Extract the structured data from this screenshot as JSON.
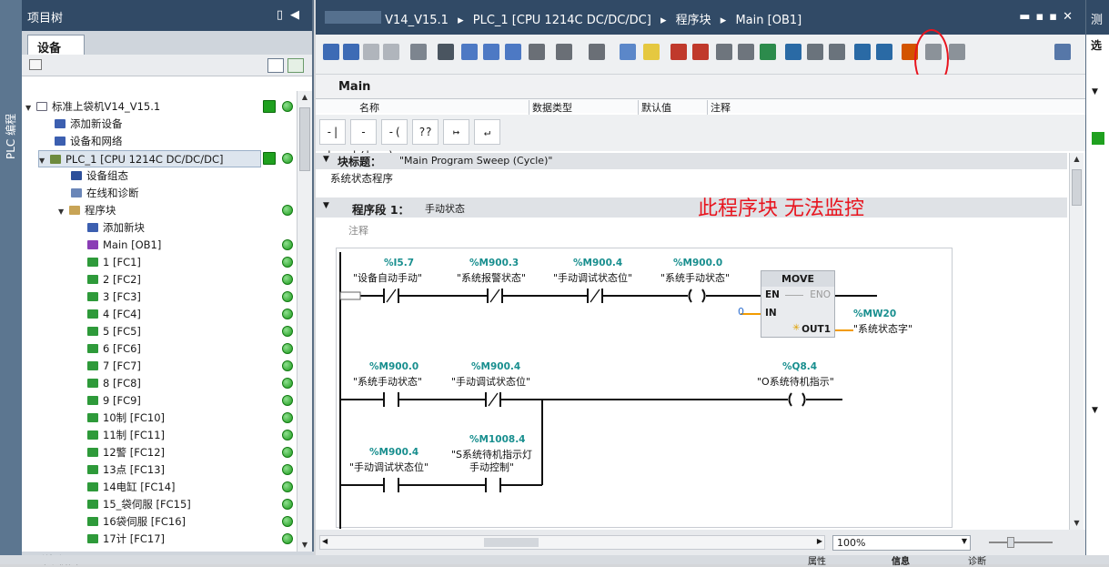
{
  "left_strip": {
    "label": "PLC 编程"
  },
  "project_tree": {
    "title": "项目树",
    "tab": "设备",
    "items": [
      {
        "label": "标准上袋机V14_V15.1",
        "status": "ok"
      },
      {
        "label": "添加新设备"
      },
      {
        "label": "设备和网络"
      },
      {
        "label": "PLC_1 [CPU 1214C DC/DC/DC]",
        "status": "ok"
      },
      {
        "label": "设备组态"
      },
      {
        "label": "在线和诊断"
      },
      {
        "label": "程序块"
      },
      {
        "label": "添加新块"
      },
      {
        "label": "Main [OB1]"
      },
      {
        "label": "1 [FC1]"
      },
      {
        "label": "2 [FC2]"
      },
      {
        "label": "3 [FC3]"
      },
      {
        "label": "4 [FC4]"
      },
      {
        "label": "5 [FC5]"
      },
      {
        "label": "6 [FC6]"
      },
      {
        "label": "7 [FC7]"
      },
      {
        "label": "8 [FC8]"
      },
      {
        "label": "9 [FC9]"
      },
      {
        "label": "10制 [FC10]"
      },
      {
        "label": "11制 [FC11]"
      },
      {
        "label": "12警 [FC12]"
      },
      {
        "label": "13点 [FC13]"
      },
      {
        "label": "14电缸 [FC14]"
      },
      {
        "label": "15_袋伺服 [FC15]"
      },
      {
        "label": "16袋伺服 [FC16]"
      },
      {
        "label": "17计 [FC17]"
      }
    ],
    "bottom_label": "详细视图"
  },
  "editor": {
    "breadcrumb": [
      "V14_V15.1",
      "PLC_1 [CPU 1214C DC/DC/DC]",
      "程序块",
      "Main [OB1]"
    ],
    "block_name": "Main",
    "interface_columns": [
      "名称",
      "数据类型",
      "默认值",
      "注释"
    ],
    "ladder_buttons": [
      "-| |-",
      "-|/|-",
      "-( )-",
      "??",
      "↦",
      "↵"
    ],
    "block_title_label": "块标题：",
    "block_title_value": "\"Main Program Sweep (Cycle)\"",
    "block_comment": "系统状态程序",
    "network_label": "程序段 1：",
    "network_title": "手动状态",
    "network_comment": "注释",
    "annotation": "此程序块  无法监控",
    "zoom": "100%"
  },
  "rung1": {
    "contacts": [
      {
        "address": "%I5.7",
        "symbol": "\"设备自动手动\""
      },
      {
        "address": "%M900.3",
        "symbol": "\"系统报警状态\""
      },
      {
        "address": "%M900.4",
        "symbol": "\"手动调试状态位\""
      }
    ],
    "coil": {
      "address": "%M900.0",
      "symbol": "\"系统手动状态\""
    },
    "box": {
      "name": "MOVE",
      "en": "EN",
      "eno": "ENO",
      "in": "IN",
      "in_value": "0",
      "out": "OUT1",
      "out_address": "%MW20",
      "out_symbol": "\"系统状态字\""
    }
  },
  "rung2": {
    "c1": {
      "address": "%M900.0",
      "symbol": "\"系统手动状态\""
    },
    "c2": {
      "address": "%M900.4",
      "symbol": "\"手动调试状态位\""
    },
    "coil": {
      "address": "%Q8.4",
      "symbol": "\"O系统待机指示\""
    },
    "c3": {
      "address": "%M900.4",
      "symbol": "\"手动调试状态位\""
    },
    "c4": {
      "address": "%M1008.4",
      "symbol1": "\"S系统待机指示灯",
      "symbol2": "手动控制\""
    }
  },
  "right_pane": {
    "title": "测",
    "tab": "选"
  },
  "bottom_tabs": [
    "属性",
    "信息",
    "诊断"
  ],
  "colors": {
    "header": "#314a66",
    "status_ok": "#1fa01f",
    "tag": "#198f8f",
    "annotation": "#e8141e"
  }
}
